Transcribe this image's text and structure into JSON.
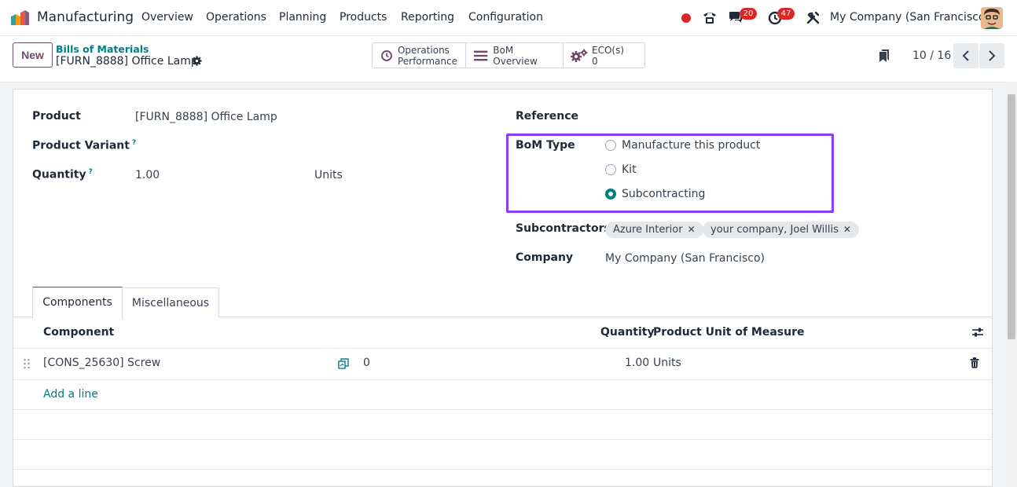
{
  "app": {
    "name": "Manufacturing",
    "menu": [
      "Overview",
      "Operations",
      "Planning",
      "Products",
      "Reporting",
      "Configuration"
    ],
    "messages_badge": "20",
    "activity_badge": "47",
    "company": "My Company (San Francisco)"
  },
  "control": {
    "new_label": "New",
    "breadcrumb": "Bills of Materials",
    "record_title": "[FURN_8888] Office Lamp",
    "smart_buttons": {
      "ops_line1": "Operations",
      "ops_line2": "Performance",
      "overview": "BoM Overview",
      "eco_label": "ECO(s)",
      "eco_count": "0"
    },
    "pager": "10 / 16"
  },
  "form": {
    "product_label": "Product",
    "product_value": "[FURN_8888] Office Lamp",
    "variant_label": "Product Variant",
    "quantity_label": "Quantity",
    "quantity_value": "1.00",
    "quantity_uom": "Units",
    "help_mark": "?",
    "reference_label": "Reference",
    "bom_type_label": "BoM Type",
    "bom_type_options": [
      "Manufacture this product",
      "Kit",
      "Subcontracting"
    ],
    "bom_type_selected": "Subcontracting",
    "subcontractors_label": "Subcontractors",
    "subcontractors": [
      "Azure Interior",
      "your company, Joel Willis"
    ],
    "tag_remove": "✕",
    "company_label": "Company",
    "company_value": "My Company (San Francisco)"
  },
  "tabs": [
    "Components",
    "Miscellaneous"
  ],
  "components_table": {
    "headers": {
      "component": "Component",
      "quantity": "Quantity",
      "uom": "Product Unit of Measure"
    },
    "rows": [
      {
        "component": "[CONS_25630] Screw",
        "availability": "0",
        "quantity": "1.00",
        "uom": "Units"
      }
    ],
    "add_line": "Add a line"
  },
  "colors": {
    "brand": "#714b67",
    "accent": "#017e84",
    "highlight": "#8b3dff",
    "badge": "#dc2626"
  }
}
